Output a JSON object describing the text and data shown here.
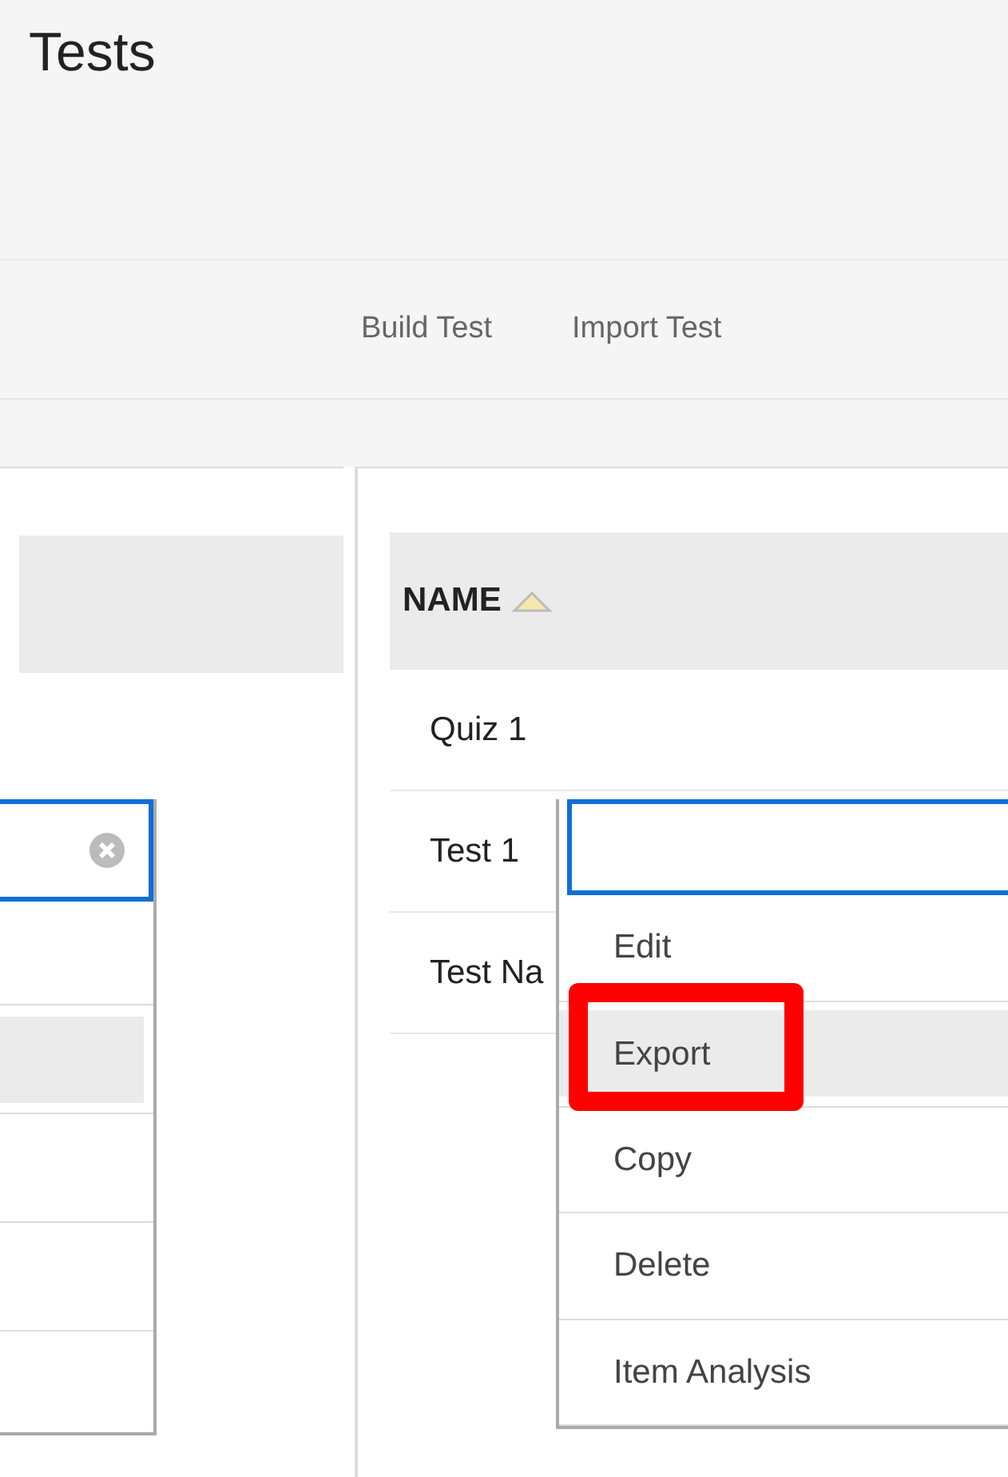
{
  "page": {
    "title": "Tests"
  },
  "toolbar": [
    {
      "label": "Build Test"
    },
    {
      "label": "Import Test"
    }
  ],
  "table": {
    "columns": [
      {
        "label": "NAME",
        "sorted": true
      }
    ],
    "rows": [
      {
        "name": "Quiz 1"
      },
      {
        "name": "Test 1"
      },
      {
        "name": "Test Na"
      }
    ]
  },
  "context_menu": {
    "items": [
      {
        "label": "Edit",
        "highlighted": false,
        "outlined": false
      },
      {
        "label": "Export",
        "highlighted": true,
        "outlined": true
      },
      {
        "label": "Copy",
        "highlighted": false,
        "outlined": false
      },
      {
        "label": "Delete",
        "highlighted": false,
        "outlined": false
      },
      {
        "label": "Item Analysis",
        "highlighted": false,
        "outlined": false
      }
    ]
  }
}
